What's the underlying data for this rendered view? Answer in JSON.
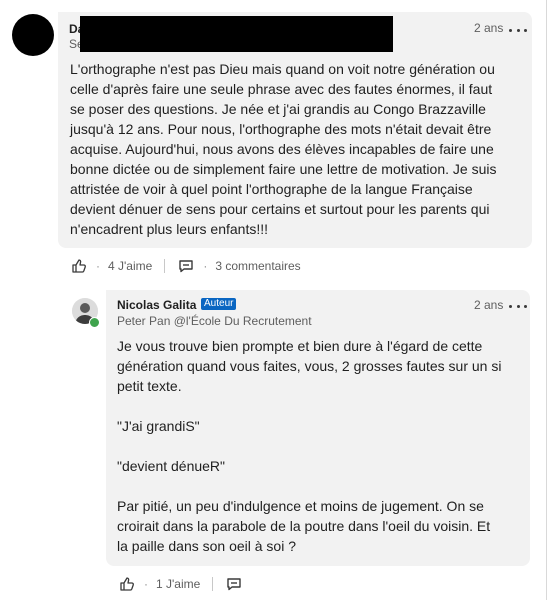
{
  "main_comment": {
    "author_visible": "Da",
    "subtitle_visible": "Se",
    "time": "2 ans",
    "text": "L'orthographe n'est pas Dieu mais quand on voit notre génération ou\ncelle d'après faire une seule phrase avec des fautes énormes, il faut\nse poser des questions. Je née et j'ai grandis au Congo Brazzaville\njusqu'à 12 ans. Pour nous, l'orthographe des mots n'était devait être\nacquise. Aujourd'hui, nous avons des élèves incapables de faire une\nbonne dictée ou de simplement faire une lettre de motivation. Je suis\nattristée de voir à quel point l'orthographe de la langue Française\ndevient dénuer de sens pour certains et surtout pour les parents qui\nn'encadrent plus leurs enfants!!!",
    "likes_label": "4 J'aime",
    "comments_label": "3 commentaires"
  },
  "reply": {
    "author": "Nicolas Galita",
    "badge": "Auteur",
    "subtitle": "Peter Pan @l'École Du Recrutement",
    "time": "2 ans",
    "text": "Je vous trouve bien prompte et bien dure à l'égard de cette\ngénération quand vous faites, vous, 2 grosses fautes sur un si\npetit texte.\n\n\"J'ai grandiS\"\n\n\"devient dénueR\"\n\nPar pitié, un peu d'indulgence et moins de jugement. On se\ncroirait dans la parabole de la poutre dans l'oeil du voisin. Et\nla paille dans son oeil à soi ?",
    "likes_label": "1 J'aime"
  },
  "icons": {
    "like": "thumbs-up-icon",
    "reply": "comment-icon",
    "more": "more-options-icon"
  },
  "colors": {
    "bubble": "#f2f2f2",
    "badge": "#0a66c2",
    "online": "#3fa34d"
  }
}
